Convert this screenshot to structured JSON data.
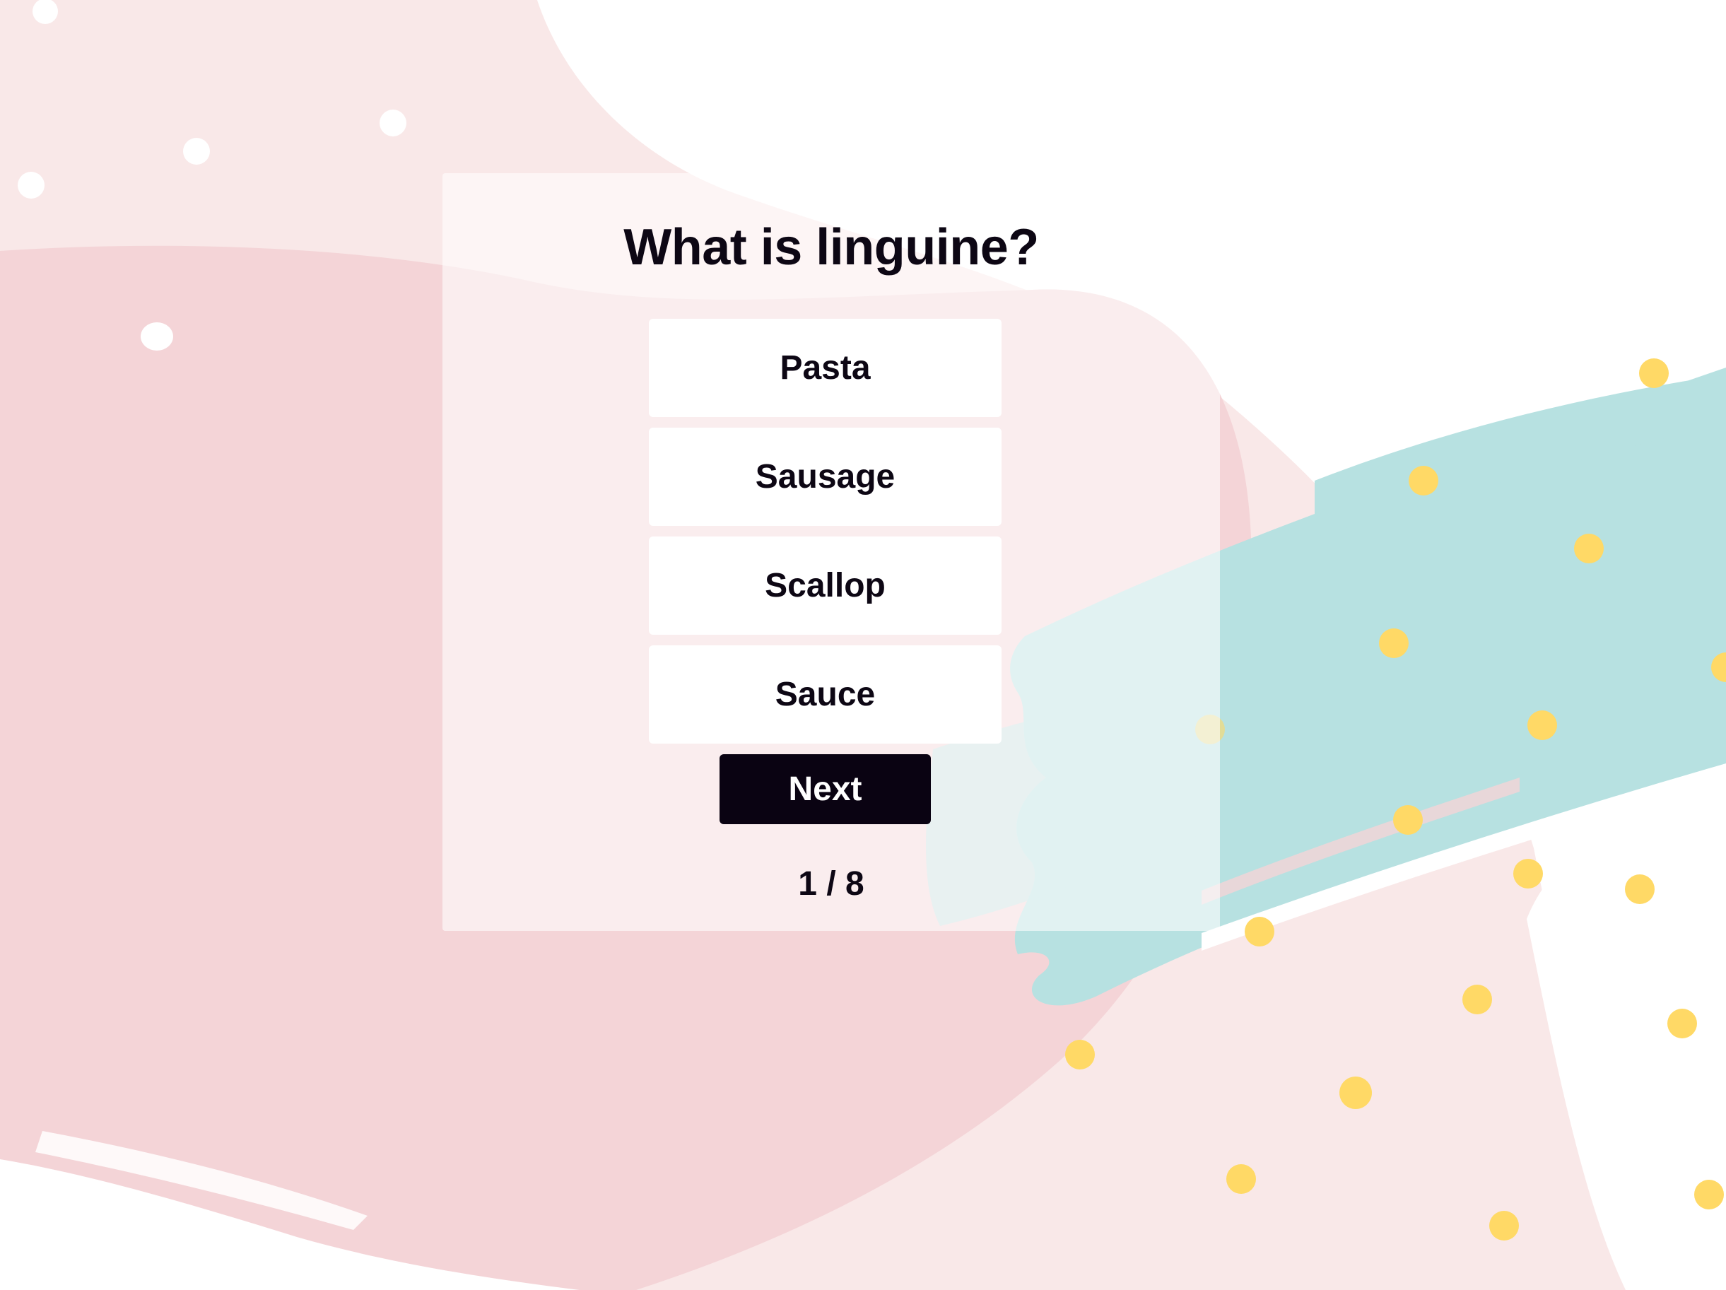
{
  "quiz": {
    "question": "What is linguine?",
    "answers": [
      {
        "label": "Pasta"
      },
      {
        "label": "Sausage"
      },
      {
        "label": "Scallop"
      },
      {
        "label": "Sauce"
      }
    ],
    "next_label": "Next",
    "progress": "1 / 8",
    "current_question": 1,
    "total_questions": 8
  },
  "colors": {
    "background": "#ffffff",
    "pale_pink": "#f9e8e8",
    "pink": "#f4d4d7",
    "teal": "#b7e1e1",
    "yellow_dot": "#ffd966",
    "text": "#0d0714",
    "button": "#0a0312"
  }
}
